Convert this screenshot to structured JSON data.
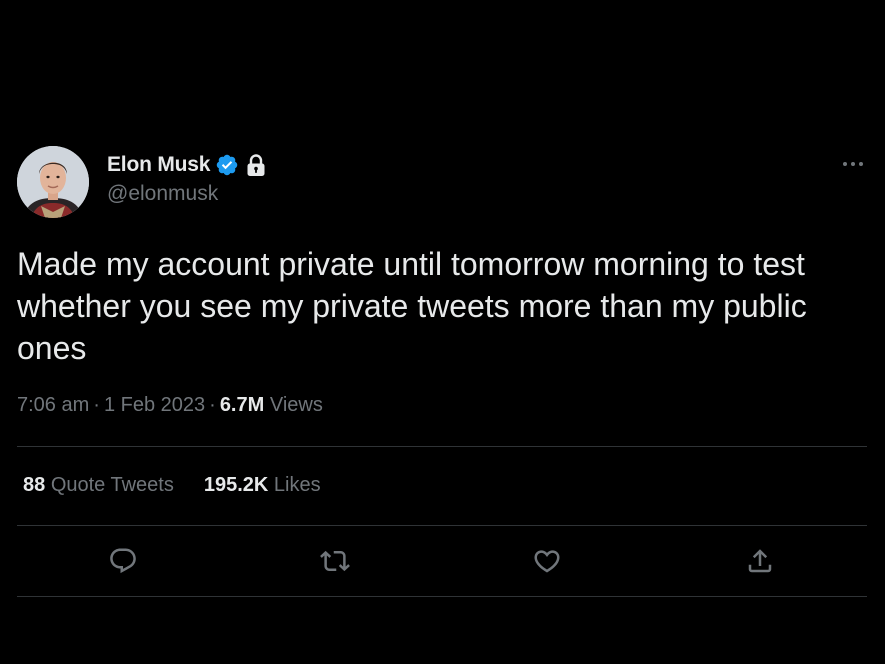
{
  "tweet": {
    "author": {
      "display_name": "Elon Musk",
      "handle": "@elonmusk",
      "verified_icon": "verified-badge-icon",
      "protected_icon": "lock-icon"
    },
    "text": "Made my account private until tomorrow morning to test whether you see my private tweets more than my public ones",
    "time": "7:06 am",
    "separator": "·",
    "date": "1 Feb 2023",
    "views_count": "6.7M",
    "views_label": "Views",
    "stats": {
      "quote_tweets_count": "88",
      "quote_tweets_label": "Quote Tweets",
      "likes_count": "195.2K",
      "likes_label": "Likes"
    },
    "actions": [
      "reply-icon",
      "retweet-icon",
      "like-icon",
      "share-icon"
    ]
  },
  "colors": {
    "background": "#000000",
    "primary_text": "#e7e9ea",
    "secondary_text": "#71767b",
    "divider": "#2f3336",
    "verified_blue": "#1d9bf0"
  }
}
